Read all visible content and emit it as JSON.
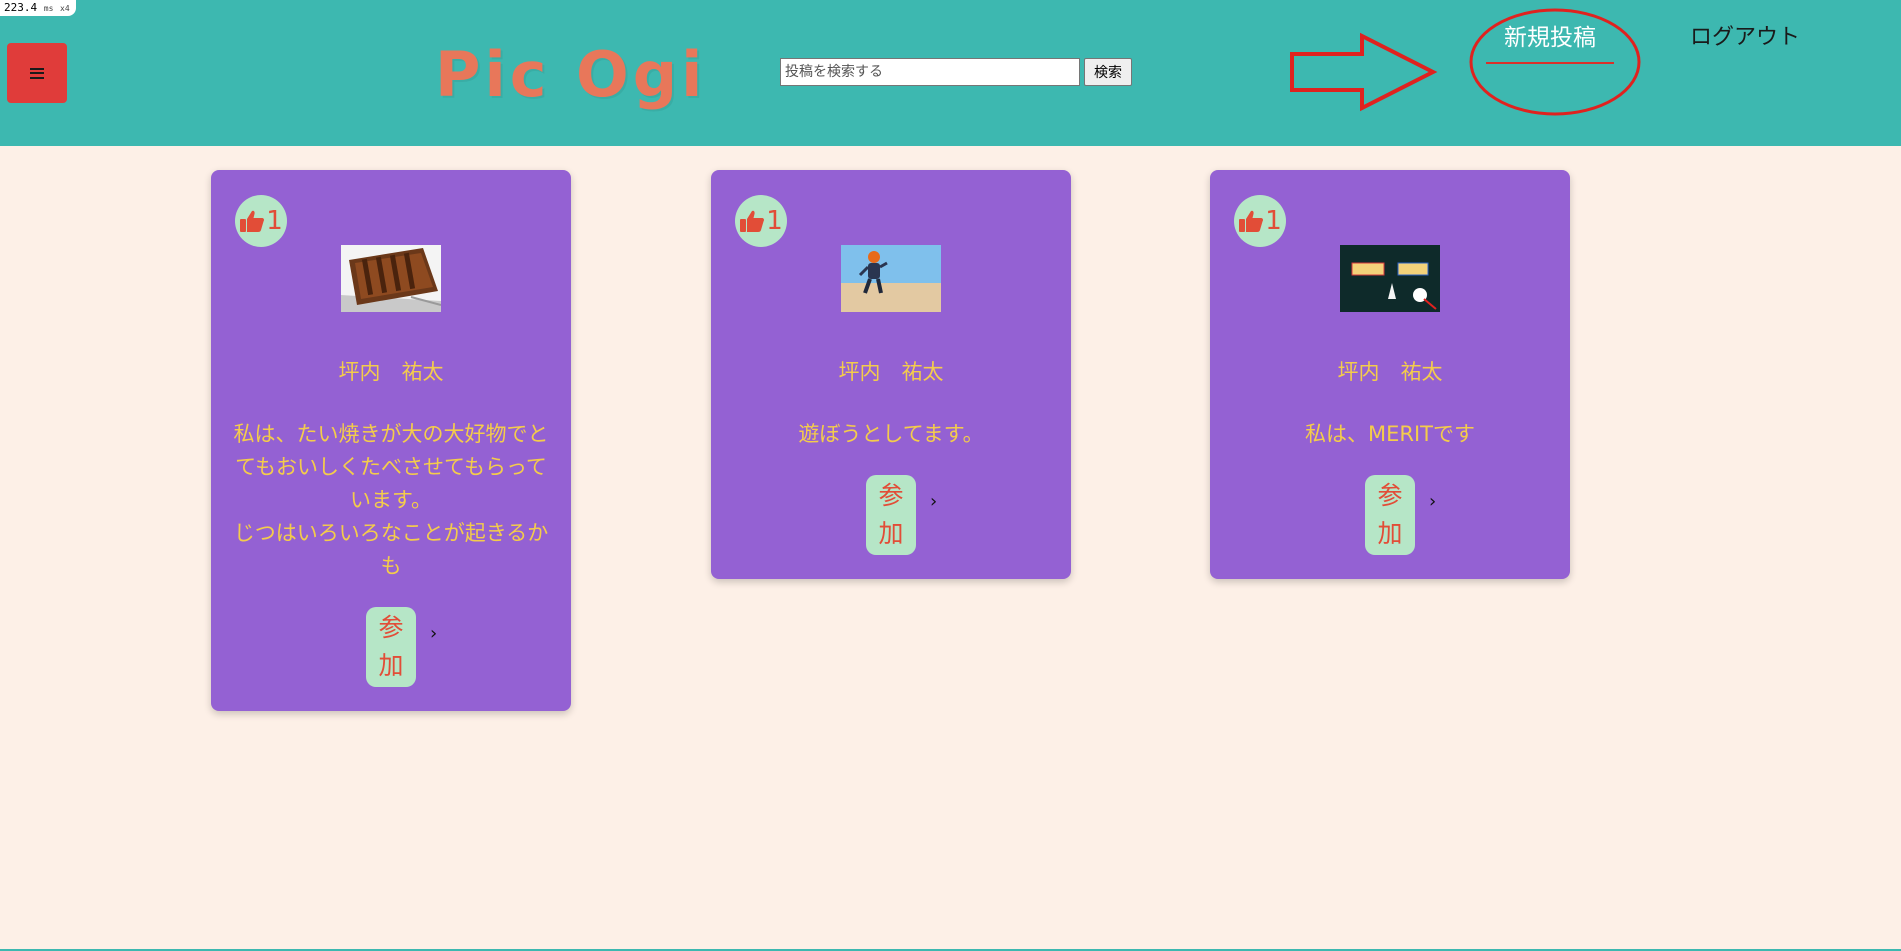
{
  "perf": {
    "value": "223.4",
    "unit": "ms",
    "mult": "x4"
  },
  "header": {
    "logo": "Pic Ogi",
    "search": {
      "placeholder": "投稿を検索する",
      "value": ""
    },
    "search_button": "検索",
    "new_post": "新規投稿",
    "logout": "ログアウト"
  },
  "cards": [
    {
      "likes": "1",
      "author": "坪内　祐太",
      "text": "私は、たい焼きが大の大好物でとてもおいしくたべさせてもらっています。\nじつはいろいろなことが起きるかも",
      "join": [
        "参",
        "加"
      ],
      "chevron": "›"
    },
    {
      "likes": "1",
      "author": "坪内　祐太",
      "text": "遊ぼうとしてます。",
      "join": [
        "参",
        "加"
      ],
      "chevron": "›"
    },
    {
      "likes": "1",
      "author": "坪内　祐太",
      "text": "私は、MERITです",
      "join": [
        "参",
        "加"
      ],
      "chevron": "›"
    }
  ],
  "colors": {
    "header_bg": "#3db8b0",
    "page_bg": "#fdf0e7",
    "card_bg": "#9461d3",
    "accent_red": "#e03c3a",
    "logo": "#e8775a",
    "text_yellow": "#f4cc4b",
    "pill_green": "#b6e6c7"
  },
  "icons": {
    "menu": "hamburger-icon",
    "like": "thumbs-up-icon",
    "annotation_arrow": "arrow-right-icon",
    "annotation_circle": "circle-highlight-icon"
  }
}
